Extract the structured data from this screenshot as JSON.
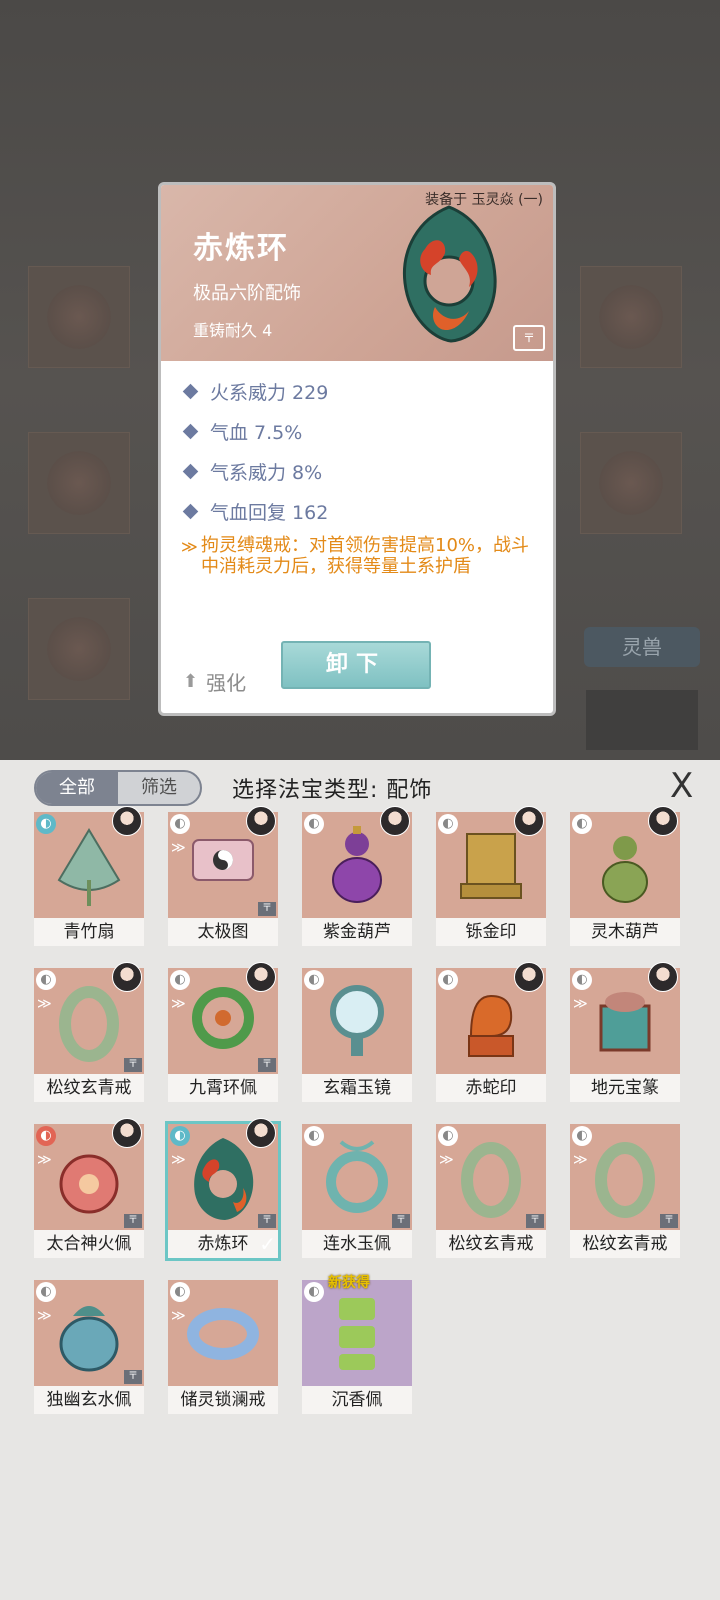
{
  "background": {
    "spirit_beast_label": "灵兽"
  },
  "detail": {
    "equipped_on": "装备于 玉灵焱 (一)",
    "name": "赤炼环",
    "grade": "极品六阶配饰",
    "durability": "重铸耐久 4",
    "lock_glyph": "〒",
    "stats": [
      {
        "text": "火系威力 229"
      },
      {
        "text": "气血 7.5%"
      },
      {
        "text": "气系威力 8%"
      },
      {
        "text": "气血回复 162"
      }
    ],
    "skill_icon": "≫",
    "skill_text": "拘灵缚魂戒：对首领伤害提高10%，战斗中消耗灵力后，获得等量土系护盾",
    "enhance_label": "强化",
    "enhance_icon": "⬆",
    "unequip_label": "卸下",
    "colors": {
      "stat": "#6c7aa0",
      "skill": "#e38a18",
      "button": "#8cc9c9"
    }
  },
  "panel": {
    "tabs": [
      {
        "label": "全部"
      },
      {
        "label": "筛选"
      }
    ],
    "title": "选择法宝类型: 配饰",
    "close_glyph": "X",
    "items": [
      {
        "name": "青竹扇"
      },
      {
        "name": "太极图"
      },
      {
        "name": "紫金葫芦"
      },
      {
        "name": "铄金印"
      },
      {
        "name": "灵木葫芦"
      },
      {
        "name": "松纹玄青戒"
      },
      {
        "name": "九霄环佩"
      },
      {
        "name": "玄霜玉镜"
      },
      {
        "name": "赤蛇印"
      },
      {
        "name": "地元宝篆"
      },
      {
        "name": "太合神火佩"
      },
      {
        "name": "赤炼环"
      },
      {
        "name": "连水玉佩"
      },
      {
        "name": "松纹玄青戒"
      },
      {
        "name": "松纹玄青戒"
      },
      {
        "name": "独幽玄水佩"
      },
      {
        "name": "储灵锁澜戒"
      },
      {
        "name": "沉香佩",
        "tag": "新获得"
      }
    ],
    "elem_glyph": "◐",
    "soul_glyph": "≫",
    "lock_glyph": "〒",
    "check_glyph": "✓"
  }
}
